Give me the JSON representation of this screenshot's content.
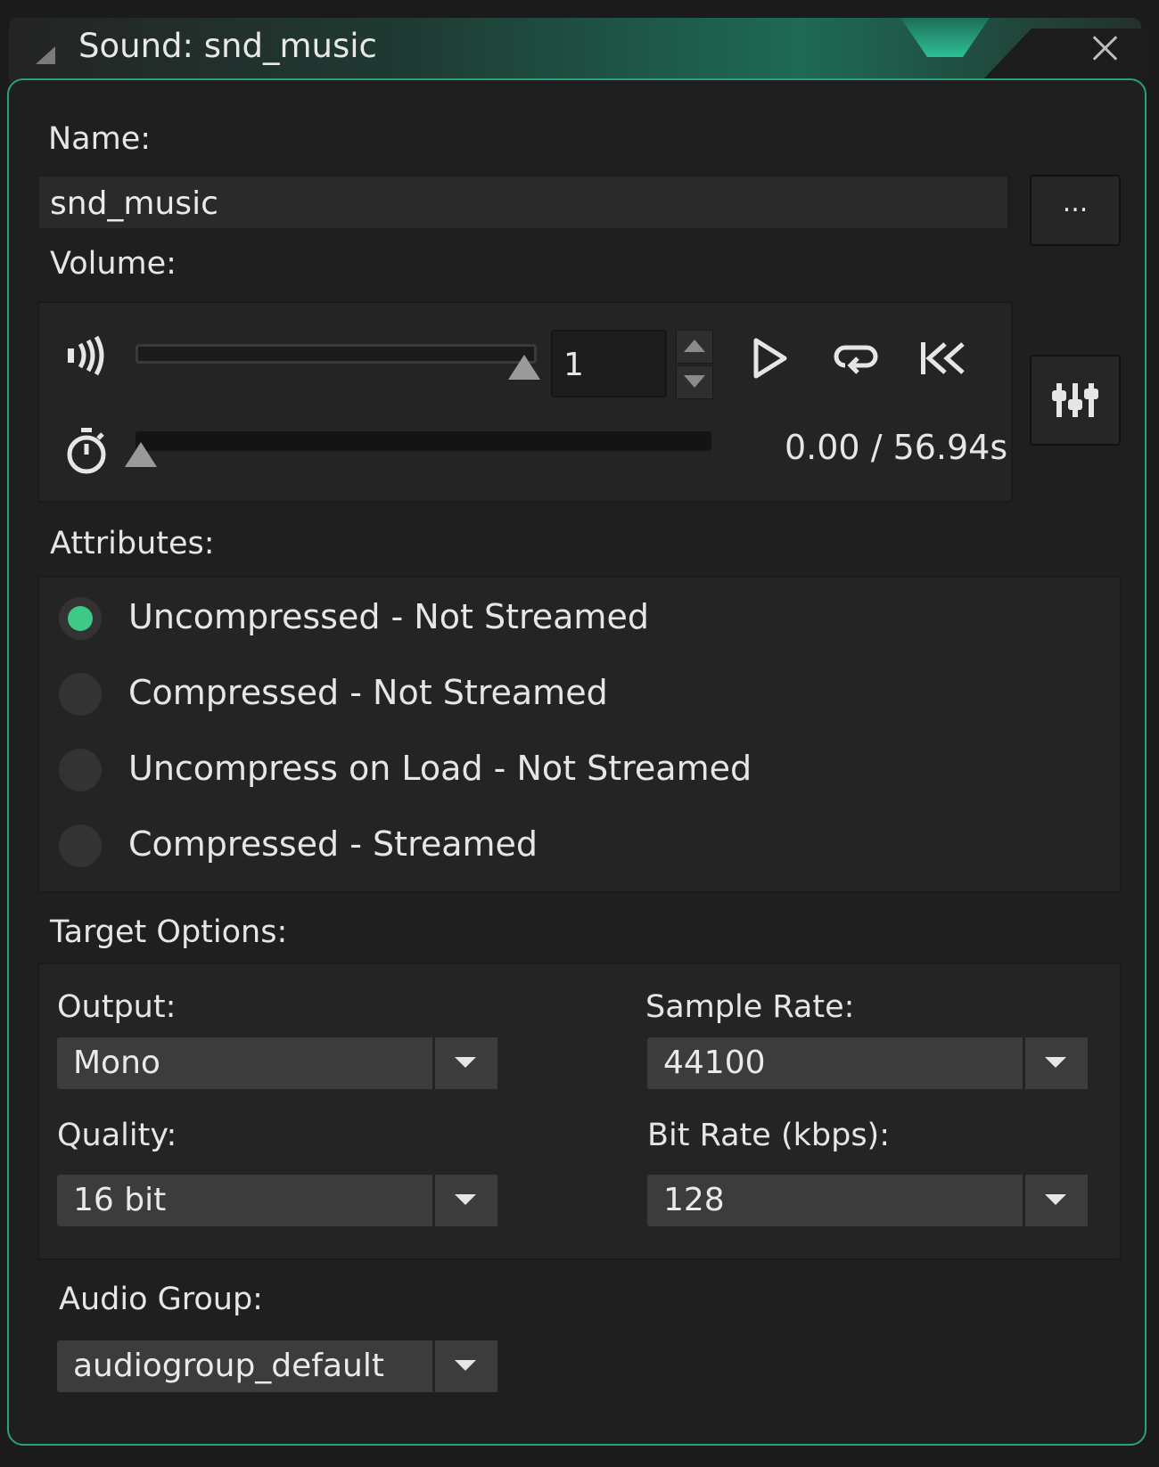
{
  "window": {
    "title": "Sound: snd_music",
    "close_icon": "close-icon",
    "collapse_icon": "collapse-triangle-icon",
    "accent_color": "#2aa07c"
  },
  "name": {
    "label": "Name:",
    "value": "snd_music",
    "browse_label": "..."
  },
  "volume": {
    "label": "Volume:",
    "value": "1",
    "level": 1.0,
    "icons": [
      "speaker-volume-icon",
      "play-icon",
      "loop-icon",
      "rewind-icon",
      "stopwatch-icon",
      "mixer-icon"
    ],
    "time_display": "0.00 / 56.94s",
    "playback_position": 0.0
  },
  "attributes": {
    "label": "Attributes:",
    "options": [
      {
        "label": "Uncompressed - Not Streamed",
        "selected": true
      },
      {
        "label": "Compressed - Not Streamed",
        "selected": false
      },
      {
        "label": "Uncompress on Load - Not Streamed",
        "selected": false
      },
      {
        "label": "Compressed - Streamed",
        "selected": false
      }
    ]
  },
  "target_options": {
    "label": "Target Options:",
    "output": {
      "label": "Output:",
      "value": "Mono"
    },
    "sample_rate": {
      "label": "Sample Rate:",
      "value": "44100"
    },
    "quality": {
      "label": "Quality:",
      "value": "16 bit"
    },
    "bit_rate": {
      "label": "Bit Rate (kbps):",
      "value": "128"
    }
  },
  "audio_group": {
    "label": "Audio Group:",
    "value": "audiogroup_default"
  }
}
